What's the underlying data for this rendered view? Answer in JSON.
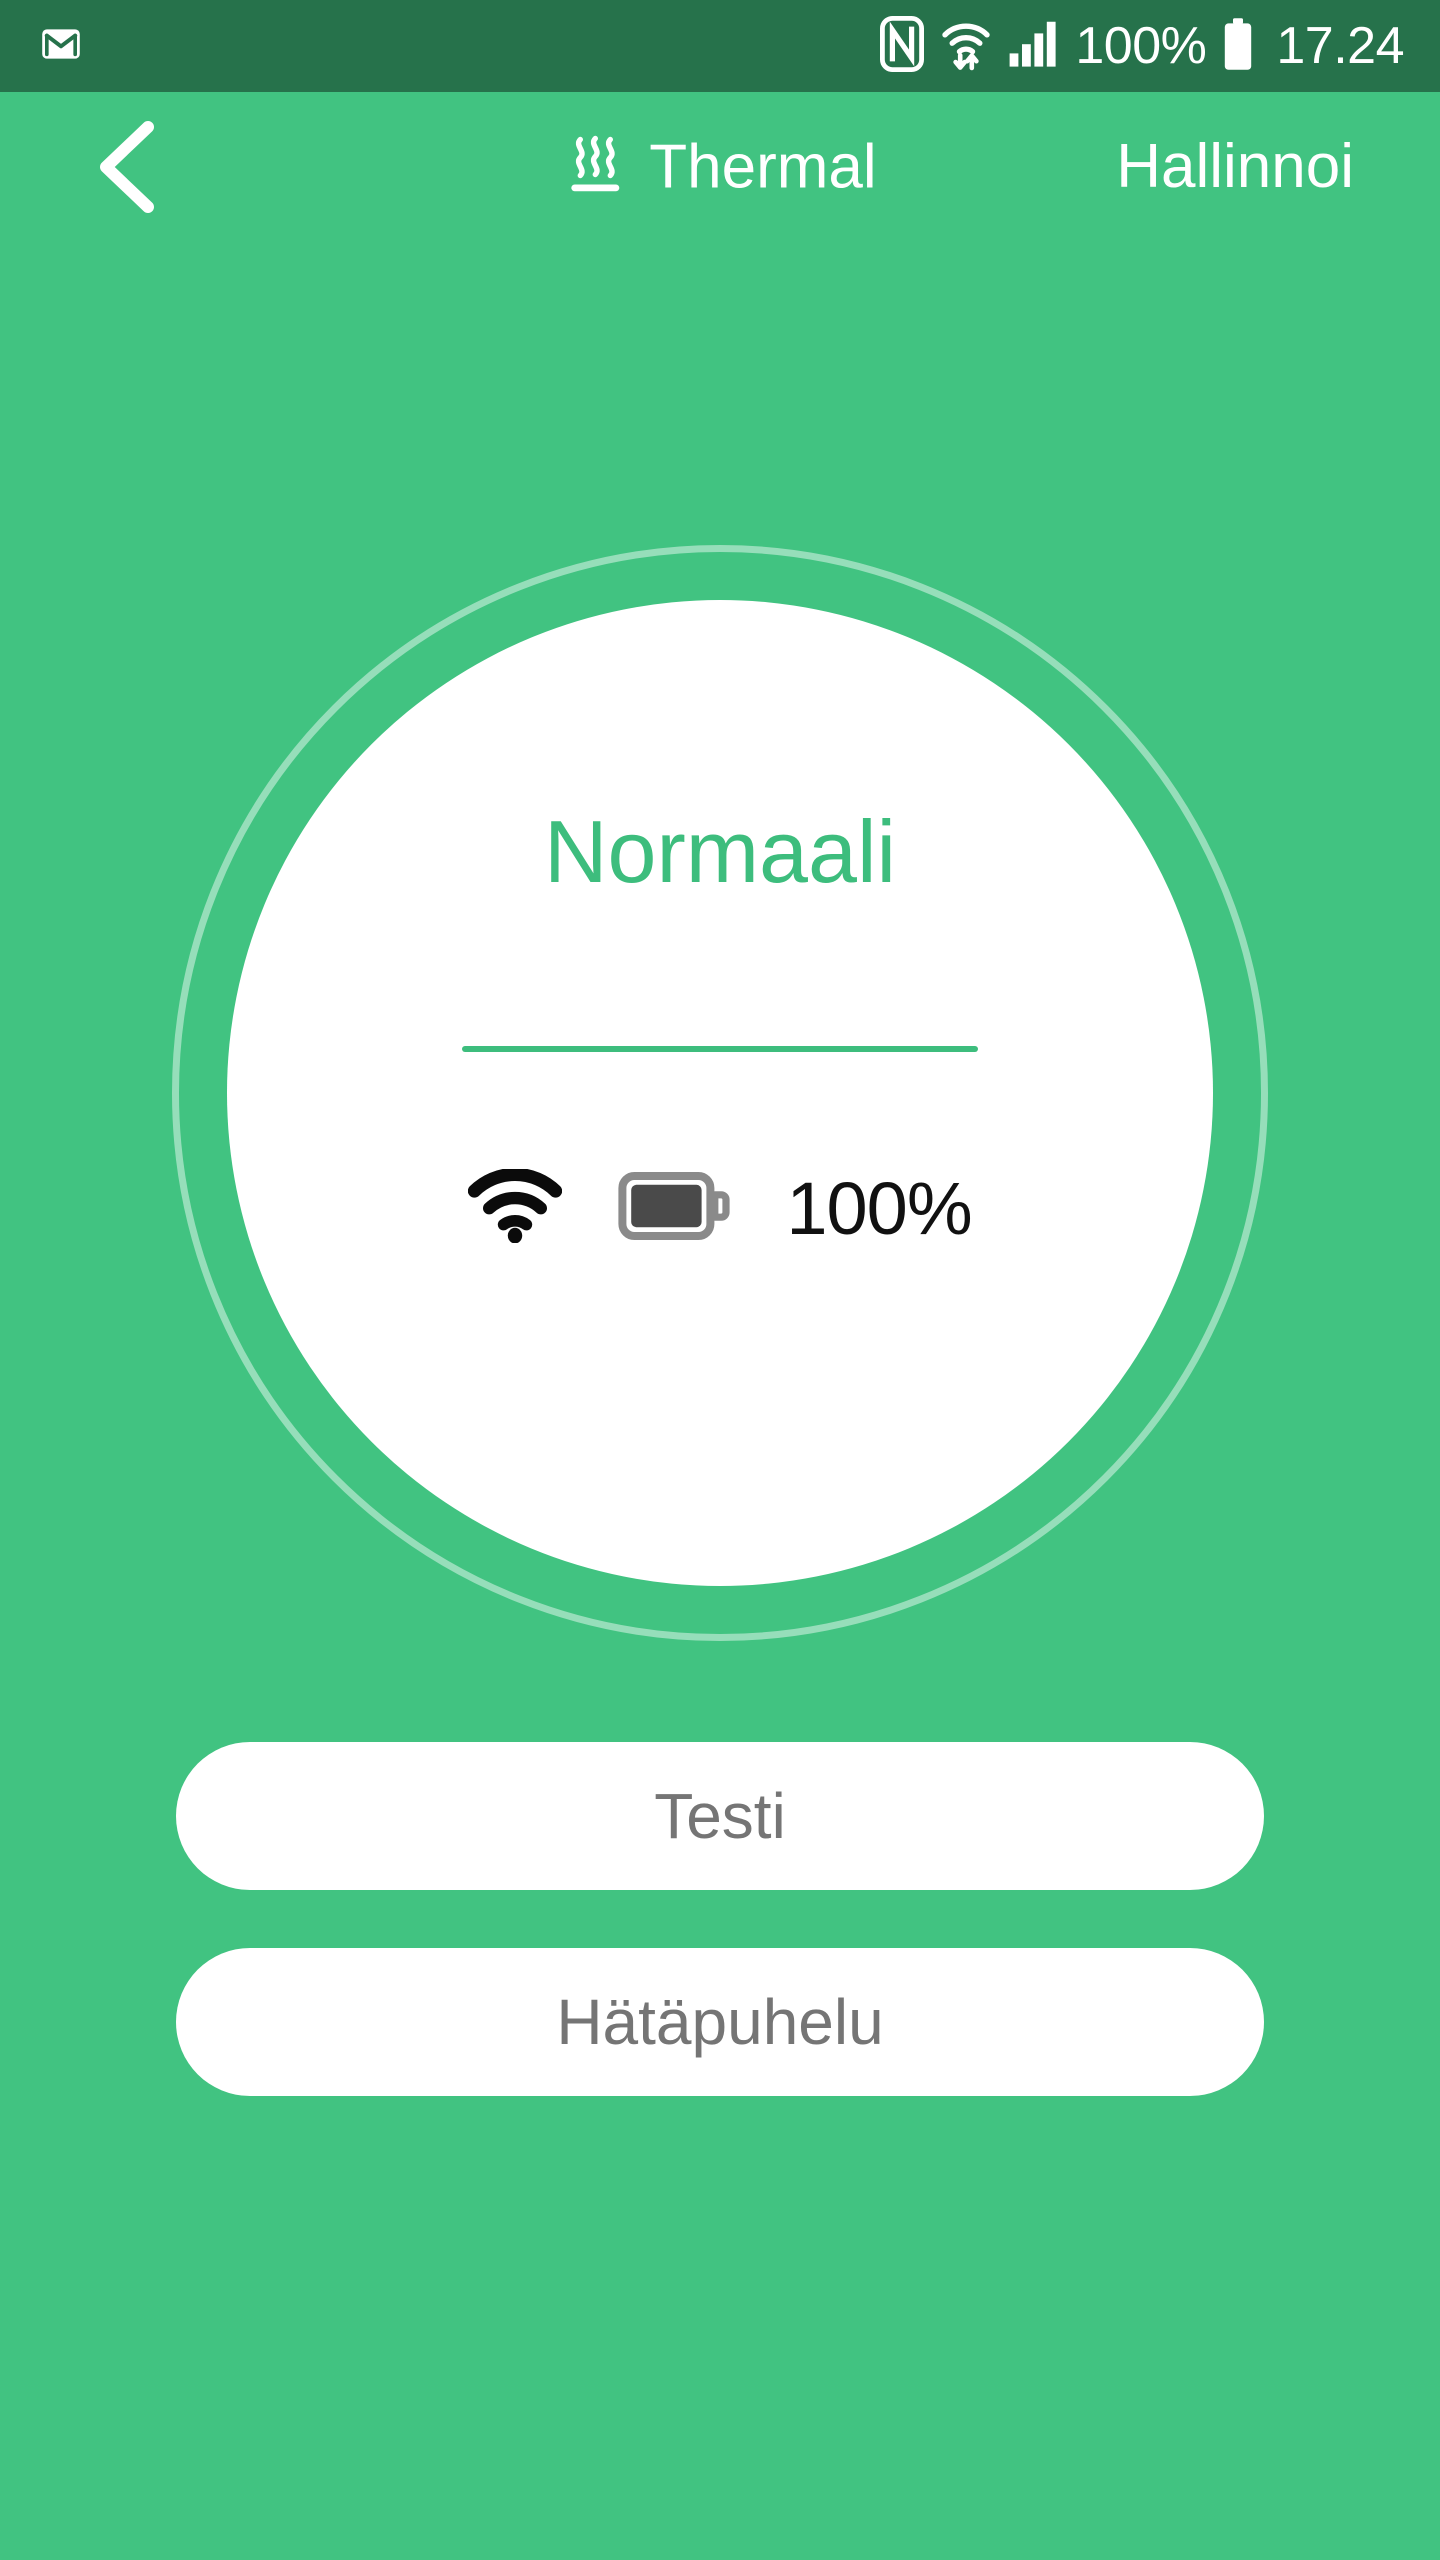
{
  "status_bar": {
    "background_color": "#26724b",
    "notification_icon": "gmail-icon",
    "nfc_icon": "nfc-icon",
    "wifi_icon": "wifi-transfer-icon",
    "signal_icon": "cellular-signal-icon",
    "battery_percent": "100%",
    "battery_icon": "battery-full-icon",
    "clock": "17.24"
  },
  "app_bar": {
    "back_icon": "chevron-left-icon",
    "thermal_icon": "heat-waves-icon",
    "title": "Thermal",
    "action_label": "Hallinnoi"
  },
  "status_dial": {
    "status_text": "Normaali",
    "status_color": "#3dbd7d",
    "wifi_icon": "wifi-icon",
    "battery_icon": "battery-horizontal-full-icon",
    "battery_percent": "100%"
  },
  "actions": {
    "test_label": "Testi",
    "emergency_call_label": "Hätäpuhelu"
  },
  "theme": {
    "background_green": "#41c381",
    "status_bar_green": "#26724b",
    "surface_white": "#ffffff",
    "button_text_gray": "#757575"
  }
}
